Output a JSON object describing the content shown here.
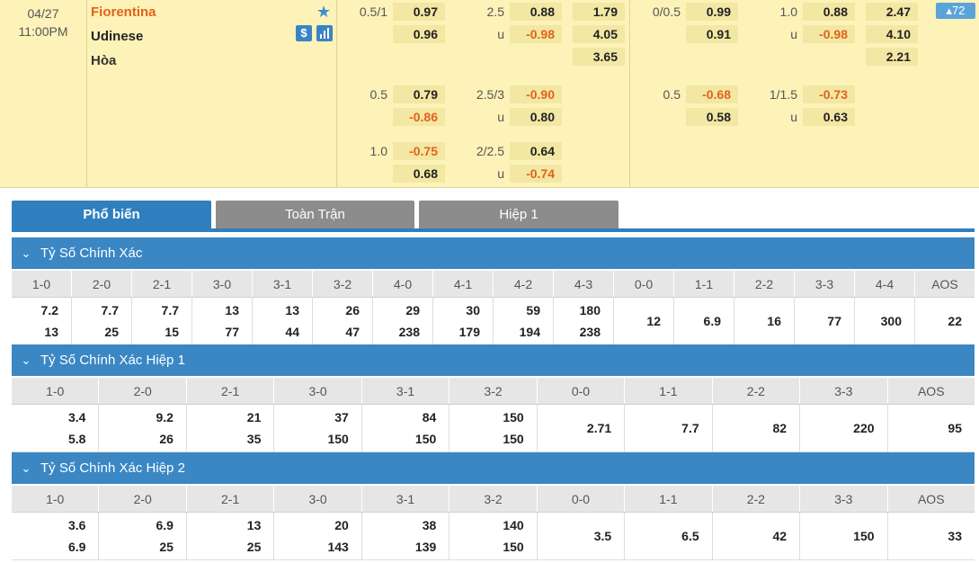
{
  "match": {
    "date": "04/27",
    "time": "11:00PM",
    "home": "Fiorentina",
    "away": "Udinese",
    "draw": "Hòa",
    "more_count": "▴72"
  },
  "full_time": {
    "rows": [
      {
        "hdp": "0.5/1",
        "h1": "0.97",
        "h2": "0.96",
        "ou": "2.5",
        "u": "u",
        "o1": "0.88",
        "o2": "-0.98",
        "x1": "1.79",
        "x2": "4.05",
        "x3": "3.65"
      },
      {
        "hdp": "0.5",
        "h1": "0.79",
        "h2": "-0.86",
        "ou": "2.5/3",
        "u": "u",
        "o1": "-0.90",
        "o2": "0.80"
      },
      {
        "hdp": "1.0",
        "h1": "-0.75",
        "h2": "0.68",
        "ou": "2/2.5",
        "u": "u",
        "o1": "0.64",
        "o2": "-0.74"
      }
    ]
  },
  "half_time": {
    "rows": [
      {
        "hdp": "0/0.5",
        "h1": "0.99",
        "h2": "0.91",
        "ou": "1.0",
        "u": "u",
        "o1": "0.88",
        "o2": "-0.98",
        "x1": "2.47",
        "x2": "4.10",
        "x3": "2.21"
      },
      {
        "hdp": "0.5",
        "h1": "-0.68",
        "h2": "0.58",
        "ou": "1/1.5",
        "u": "u",
        "o1": "-0.73",
        "o2": "0.63"
      }
    ]
  },
  "tabs": [
    "Phổ biến",
    "Toàn Trận",
    "Hiệp 1"
  ],
  "sections": [
    {
      "title": "Tỷ Số Chính Xác",
      "headers": [
        "1-0",
        "2-0",
        "2-1",
        "3-0",
        "3-1",
        "3-2",
        "4-0",
        "4-1",
        "4-2",
        "4-3",
        "0-0",
        "1-1",
        "2-2",
        "3-3",
        "4-4",
        "AOS"
      ],
      "values": [
        [
          "7.2",
          "13"
        ],
        [
          "7.7",
          "25"
        ],
        [
          "7.7",
          "15"
        ],
        [
          "13",
          "77"
        ],
        [
          "13",
          "44"
        ],
        [
          "26",
          "47"
        ],
        [
          "29",
          "238"
        ],
        [
          "30",
          "179"
        ],
        [
          "59",
          "194"
        ],
        [
          "180",
          "238"
        ],
        [
          "12"
        ],
        [
          "6.9"
        ],
        [
          "16"
        ],
        [
          "77"
        ],
        [
          "300"
        ],
        [
          "22"
        ]
      ]
    },
    {
      "title": "Tỷ Số Chính Xác Hiệp 1",
      "headers": [
        "1-0",
        "2-0",
        "2-1",
        "3-0",
        "3-1",
        "3-2",
        "0-0",
        "1-1",
        "2-2",
        "3-3",
        "AOS"
      ],
      "values": [
        [
          "3.4",
          "5.8"
        ],
        [
          "9.2",
          "26"
        ],
        [
          "21",
          "35"
        ],
        [
          "37",
          "150"
        ],
        [
          "84",
          "150"
        ],
        [
          "150",
          "150"
        ],
        [
          "2.71"
        ],
        [
          "7.7"
        ],
        [
          "82"
        ],
        [
          "220"
        ],
        [
          "95"
        ]
      ]
    },
    {
      "title": "Tỷ Số Chính Xác Hiệp 2",
      "headers": [
        "1-0",
        "2-0",
        "2-1",
        "3-0",
        "3-1",
        "3-2",
        "0-0",
        "1-1",
        "2-2",
        "3-3",
        "AOS"
      ],
      "values": [
        [
          "3.6",
          "6.9"
        ],
        [
          "6.9",
          "25"
        ],
        [
          "13",
          "25"
        ],
        [
          "20",
          "143"
        ],
        [
          "38",
          "139"
        ],
        [
          "140",
          "150"
        ],
        [
          "3.5"
        ],
        [
          "6.5"
        ],
        [
          "42"
        ],
        [
          "150"
        ],
        [
          "33"
        ]
      ]
    }
  ],
  "colors": {
    "accent": "#2f7fbf",
    "negative": "#e2631a",
    "band": "#fdf2b8"
  }
}
